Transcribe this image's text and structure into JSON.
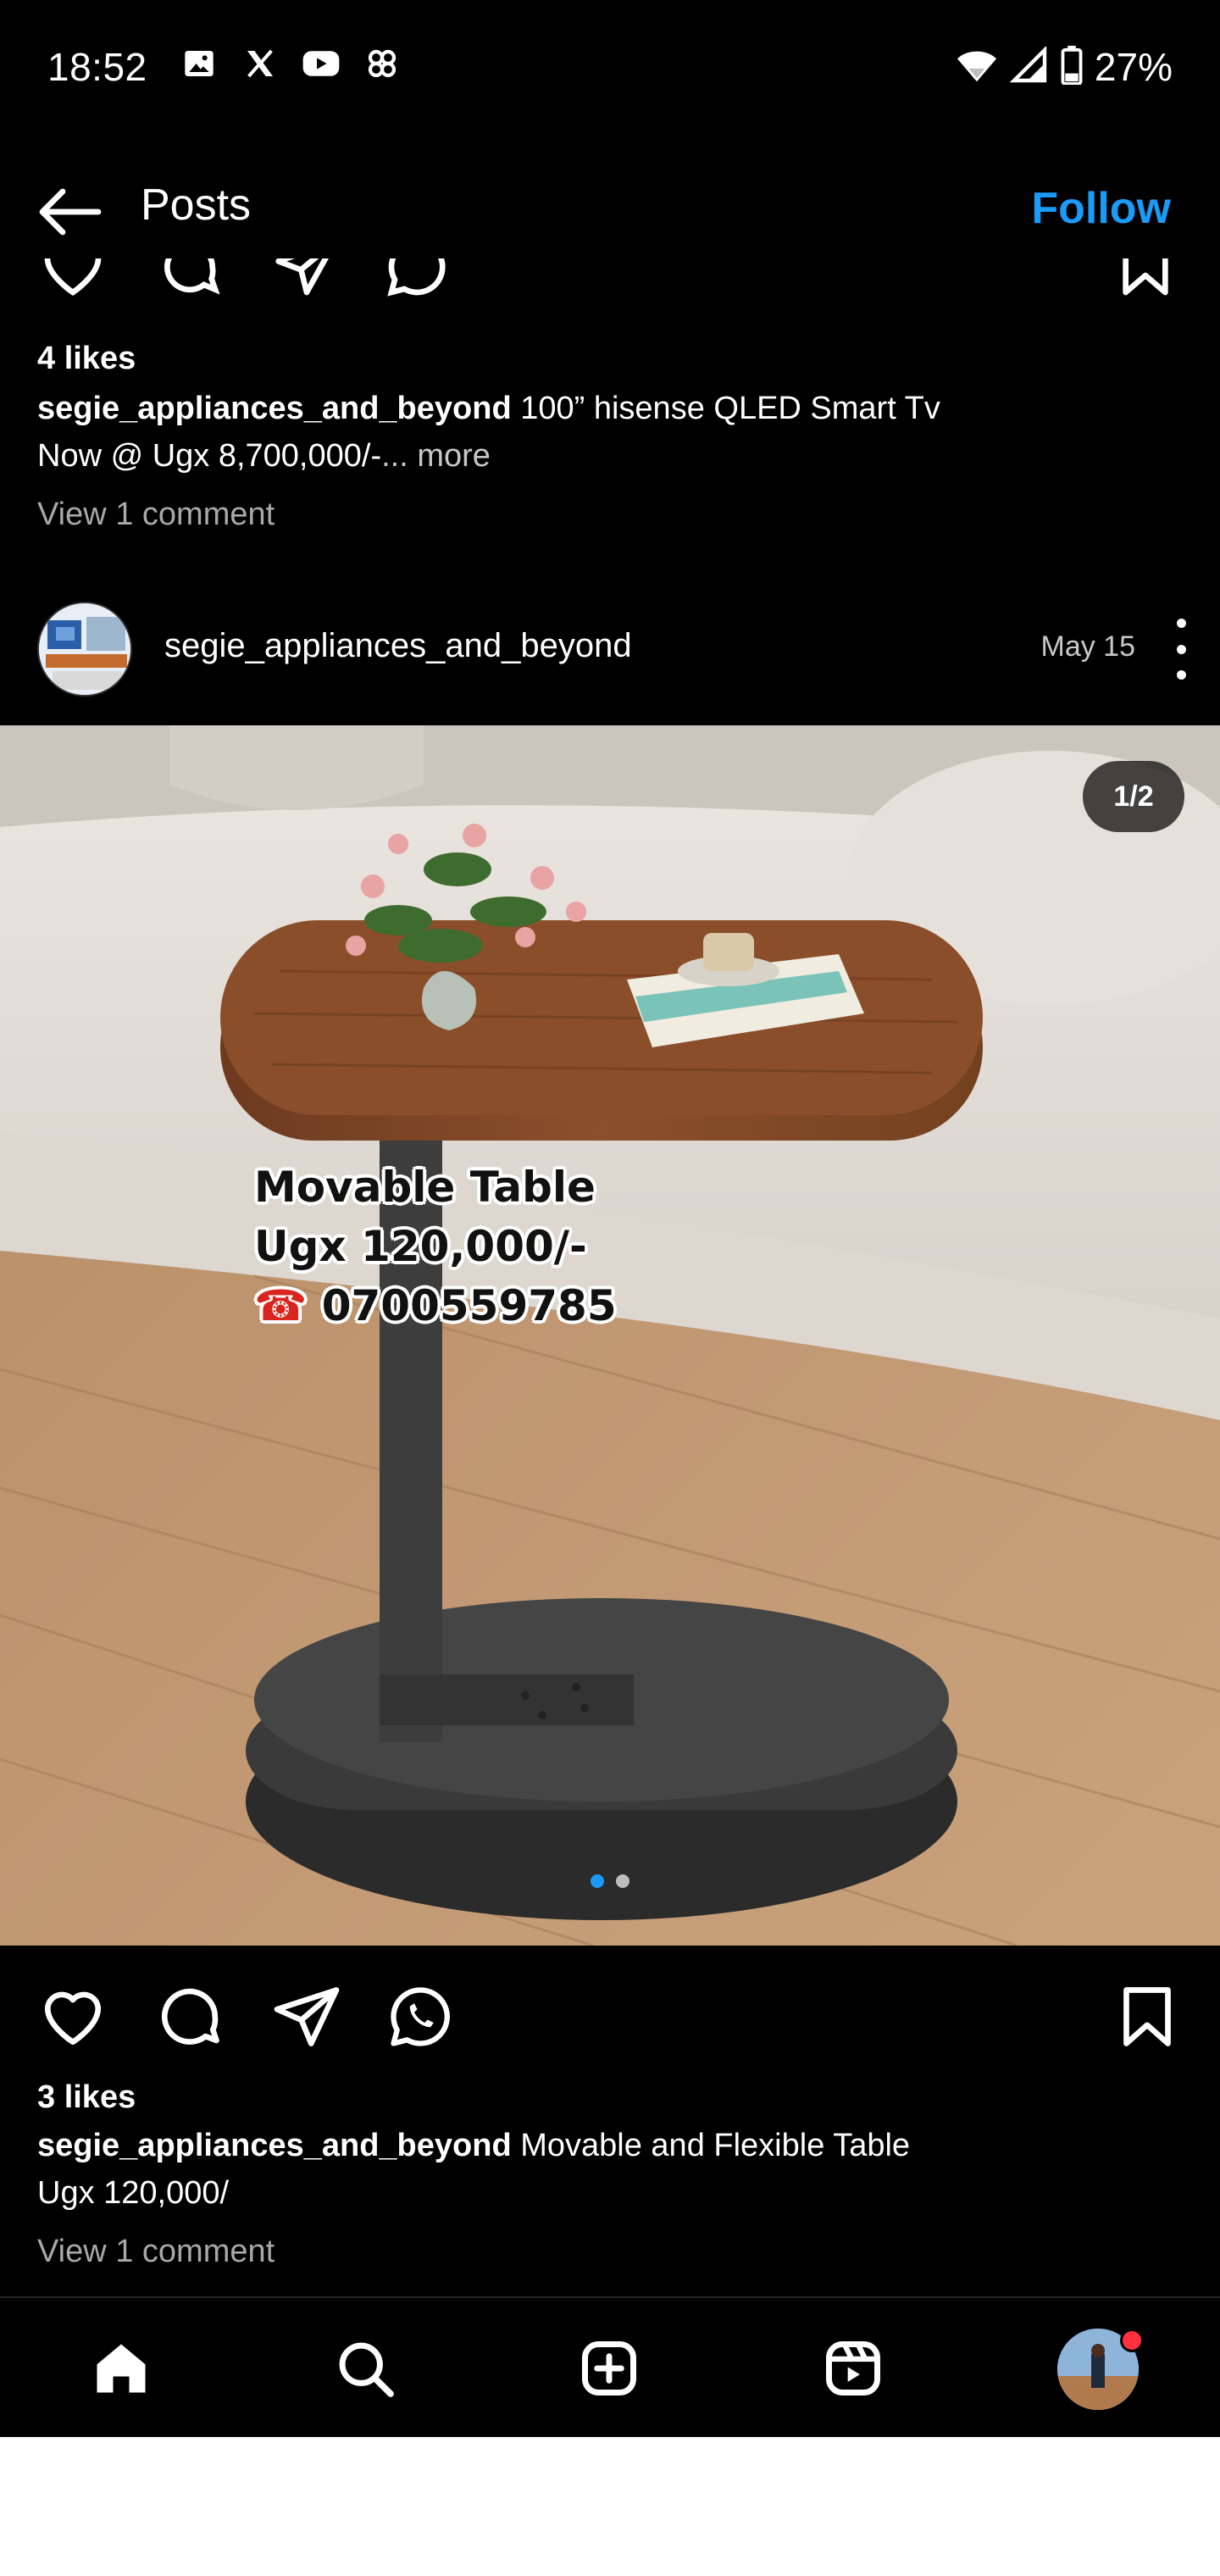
{
  "status_bar": {
    "time": "18:52",
    "battery": "27%",
    "left_icons": [
      "gallery-icon",
      "x-icon",
      "youtube-icon",
      "pinwheel-icon"
    ],
    "right_icons": [
      "wifi-icon",
      "signal-icon",
      "battery-icon"
    ]
  },
  "header": {
    "title": "Posts",
    "follow_label": "Follow"
  },
  "previous_post": {
    "likes": "4 likes",
    "username": "segie_appliances_and_beyond",
    "caption_line1": "100” hisense QLED Smart Tv",
    "caption_line2": "Now @ Ugx 8,700,000/-",
    "more_label": "... more",
    "view_comments": "View 1 comment"
  },
  "post": {
    "username": "segie_appliances_and_beyond",
    "date": "May 15",
    "counter": "1/2",
    "overlay_line1": "Movable Table",
    "overlay_line2": "Ugx 120,000/-",
    "overlay_phone_icon": "☎",
    "overlay_line3": "0700559785",
    "carousel_total": 2,
    "carousel_active": 1,
    "likes": "3 likes",
    "caption_line1": "Movable and Flexible Table",
    "caption_line2": "Ugx 120,000/",
    "view_comments": "View 1 comment"
  },
  "bottom_nav": {
    "items": [
      "home-icon",
      "search-icon",
      "create-icon",
      "reels-icon",
      "profile-avatar"
    ]
  },
  "colors": {
    "accent": "#1b9af7",
    "background": "#000000",
    "notification": "#ff3040"
  }
}
